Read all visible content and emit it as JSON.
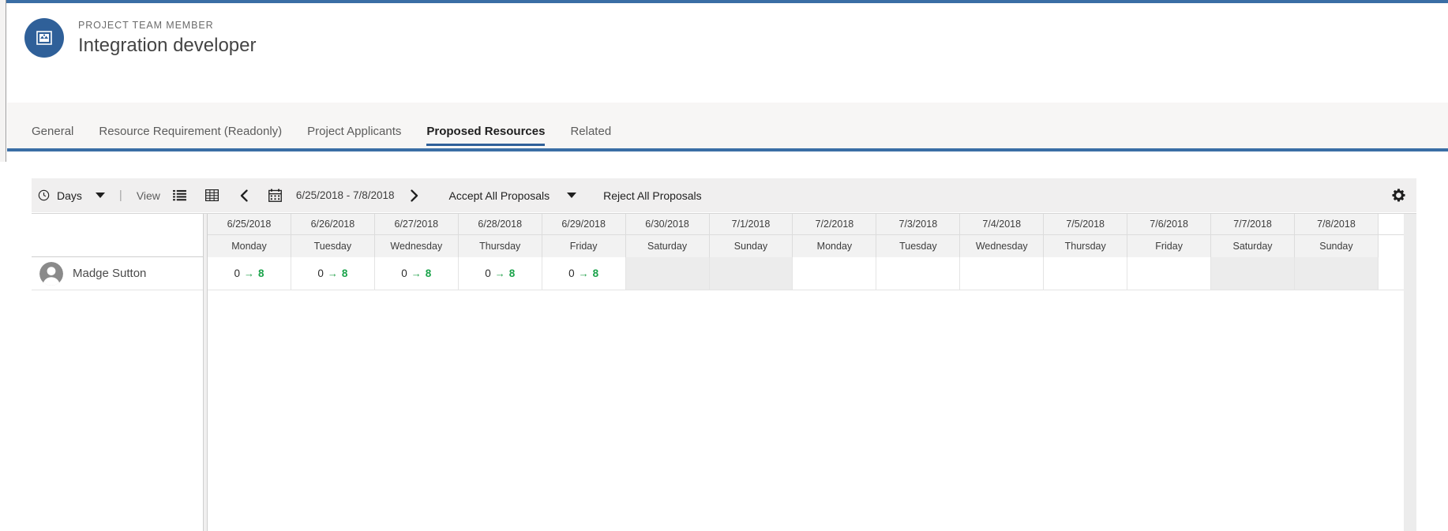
{
  "record": {
    "eyebrow": "PROJECT TEAM MEMBER",
    "title": "Integration developer",
    "avatar_icon": "project-team-member-icon",
    "avatar_color": "#2f6099"
  },
  "tabs": [
    {
      "label": "General",
      "active": false
    },
    {
      "label": "Resource Requirement (Readonly)",
      "active": false
    },
    {
      "label": "Project Applicants",
      "active": false
    },
    {
      "label": "Proposed Resources",
      "active": true
    },
    {
      "label": "Related",
      "active": false
    }
  ],
  "toolbar": {
    "clock_icon": "clock-icon",
    "scale_label": "Days",
    "scale_caret_icon": "chevron-down-icon",
    "separator": "|",
    "view_label": "View",
    "list_view_icon": "list-view-icon",
    "grid_view_icon": "grid-view-icon",
    "prev_icon": "chevron-left-icon",
    "calendar_icon": "calendar-icon",
    "date_range": "6/25/2018 - 7/8/2018",
    "next_icon": "chevron-right-icon",
    "accept_all_label": "Accept All Proposals",
    "accept_caret_icon": "chevron-down-icon",
    "reject_all_label": "Reject All Proposals",
    "settings_icon": "gear-icon",
    "accent_color": "#3a6ea5"
  },
  "scheduler": {
    "columns": [
      {
        "date": "6/25/2018",
        "day": "Monday",
        "weekend": false
      },
      {
        "date": "6/26/2018",
        "day": "Tuesday",
        "weekend": false
      },
      {
        "date": "6/27/2018",
        "day": "Wednesday",
        "weekend": false
      },
      {
        "date": "6/28/2018",
        "day": "Thursday",
        "weekend": false
      },
      {
        "date": "6/29/2018",
        "day": "Friday",
        "weekend": false
      },
      {
        "date": "6/30/2018",
        "day": "Saturday",
        "weekend": true
      },
      {
        "date": "7/1/2018",
        "day": "Sunday",
        "weekend": true
      },
      {
        "date": "7/2/2018",
        "day": "Monday",
        "weekend": false
      },
      {
        "date": "7/3/2018",
        "day": "Tuesday",
        "weekend": false
      },
      {
        "date": "7/4/2018",
        "day": "Wednesday",
        "weekend": false
      },
      {
        "date": "7/5/2018",
        "day": "Thursday",
        "weekend": false
      },
      {
        "date": "7/6/2018",
        "day": "Friday",
        "weekend": false
      },
      {
        "date": "7/7/2018",
        "day": "Saturday",
        "weekend": true
      },
      {
        "date": "7/8/2018",
        "day": "Sunday",
        "weekend": true
      }
    ],
    "rows": [
      {
        "name": "Madge Sutton",
        "avatar_icon": "person-avatar-icon",
        "cells": [
          {
            "from": "0",
            "arrow": "→",
            "to": "8"
          },
          {
            "from": "0",
            "arrow": "→",
            "to": "8"
          },
          {
            "from": "0",
            "arrow": "→",
            "to": "8"
          },
          {
            "from": "0",
            "arrow": "→",
            "to": "8"
          },
          {
            "from": "0",
            "arrow": "→",
            "to": "8"
          },
          {
            "from": "",
            "arrow": "",
            "to": ""
          },
          {
            "from": "",
            "arrow": "",
            "to": ""
          },
          {
            "from": "",
            "arrow": "",
            "to": ""
          },
          {
            "from": "",
            "arrow": "",
            "to": ""
          },
          {
            "from": "",
            "arrow": "",
            "to": ""
          },
          {
            "from": "",
            "arrow": "",
            "to": ""
          },
          {
            "from": "",
            "arrow": "",
            "to": ""
          },
          {
            "from": "",
            "arrow": "",
            "to": ""
          },
          {
            "from": "",
            "arrow": "",
            "to": ""
          }
        ]
      }
    ],
    "allocation_color": "#1aa34a"
  }
}
